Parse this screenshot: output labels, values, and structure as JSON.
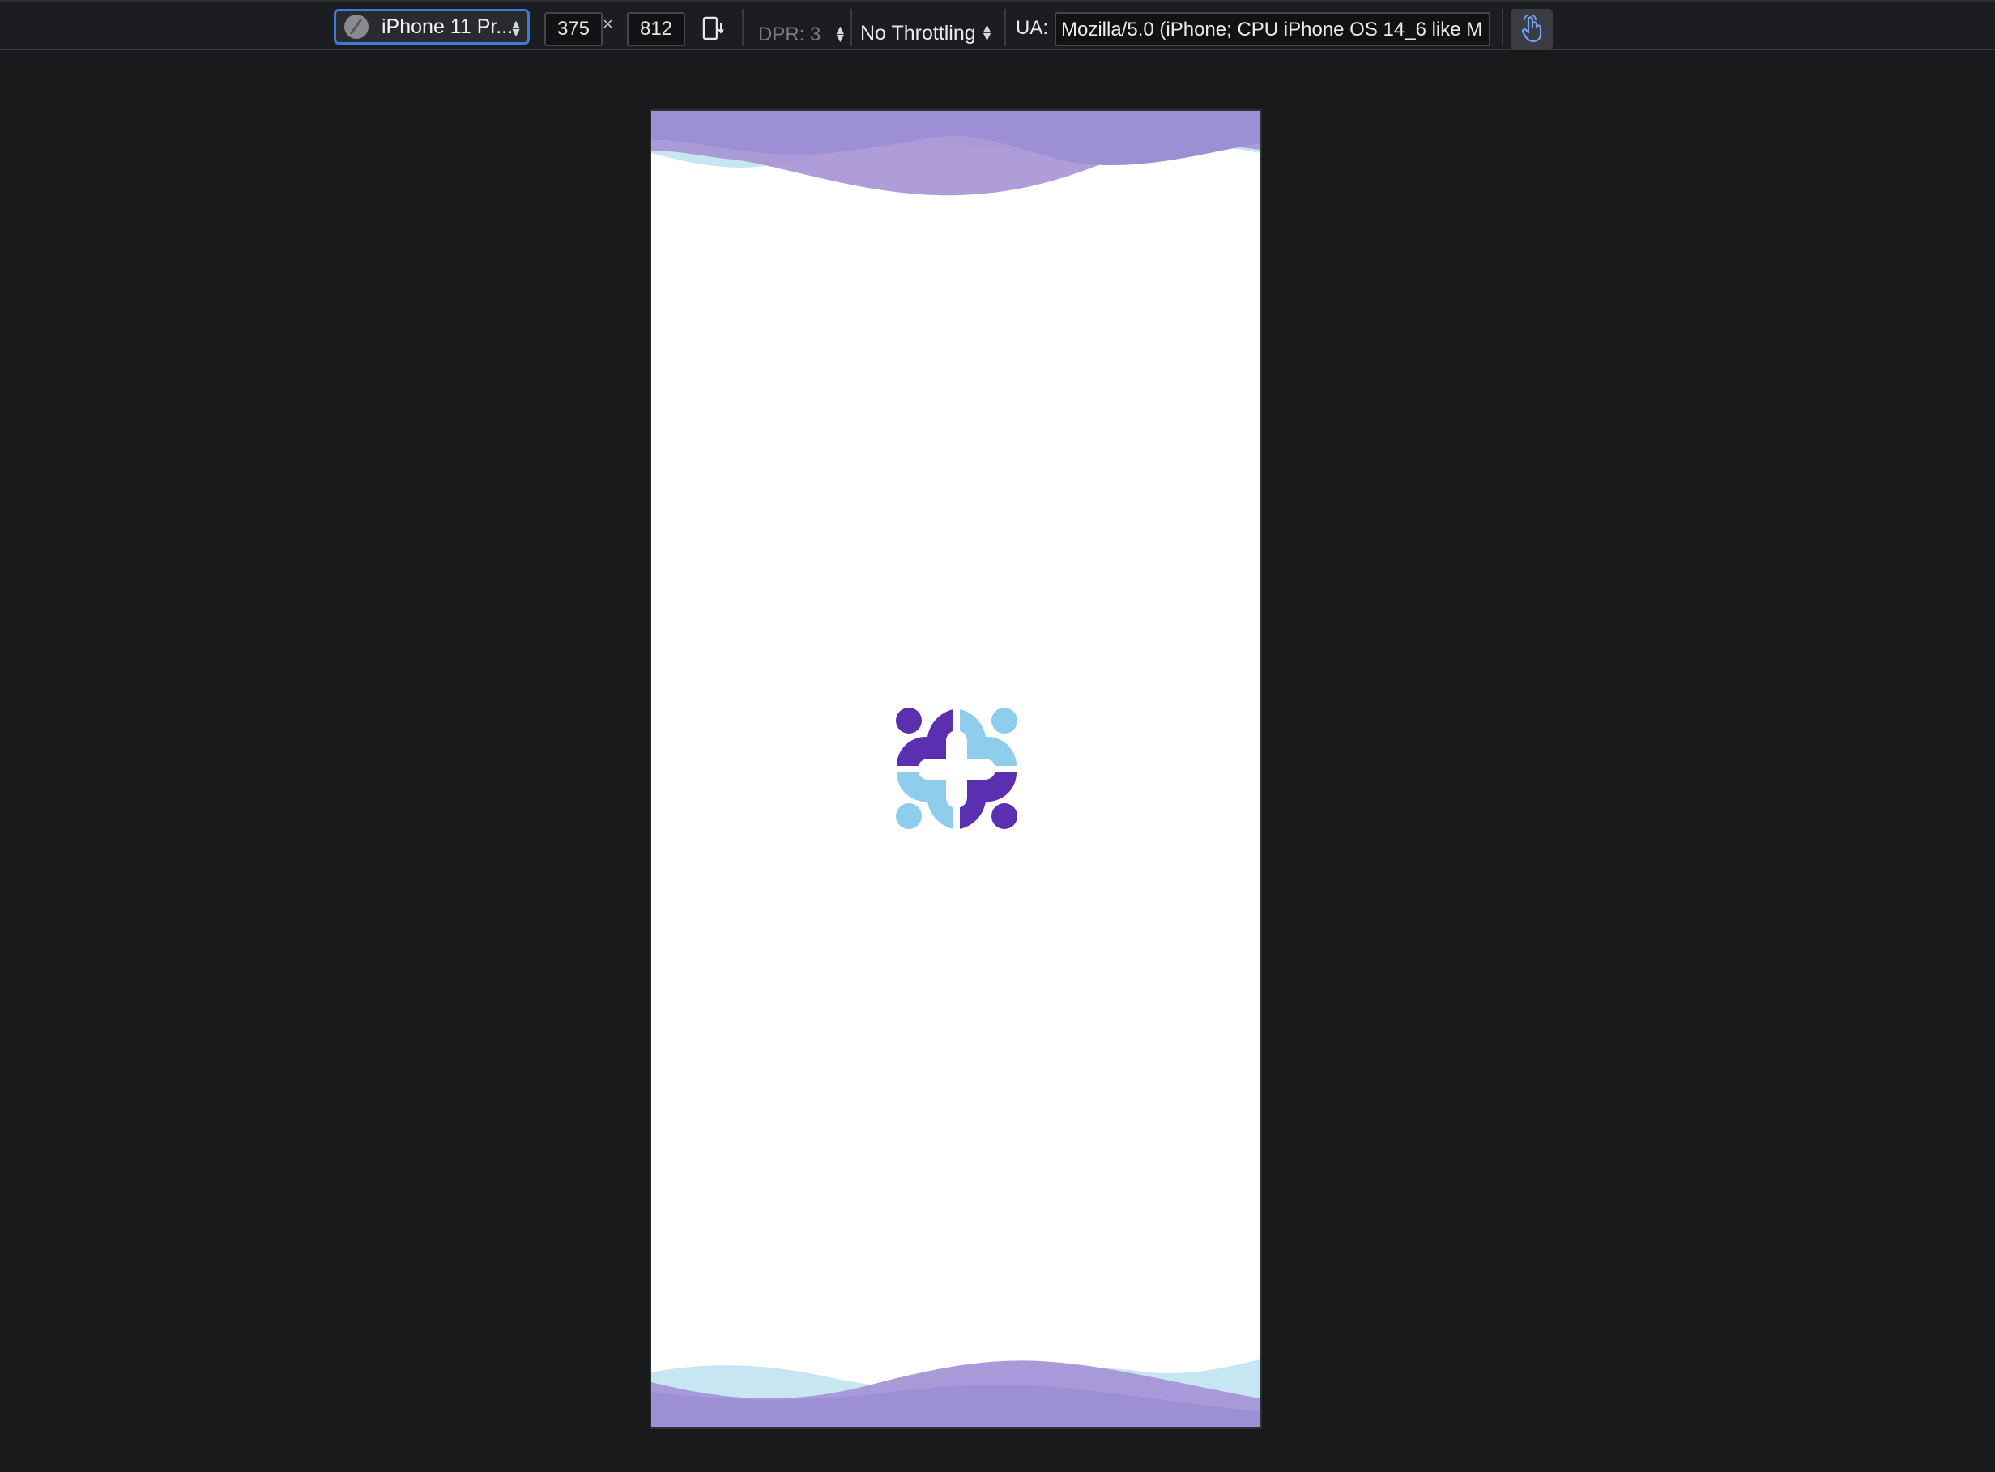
{
  "toolbar": {
    "device": {
      "label": "iPhone 11 Pr...",
      "icon": "globe-icon"
    },
    "width_value": "375",
    "times_symbol": "×",
    "height_value": "812",
    "rotate_icon": "rotate-device-icon",
    "dpr_label": "DPR: 3",
    "throttling_label": "No Throttling",
    "ua_label": "UA:",
    "ua_value": "Mozilla/5.0 (iPhone; CPU iPhone OS 14_6 like M",
    "touch_icon": "touch-simulation-icon"
  },
  "colors": {
    "background": "#18191b",
    "accent": "#3d7bd8",
    "wave_purple": "#9c8fd4",
    "wave_blue": "#c6e6f2",
    "logo_purple": "#5a2fb0",
    "logo_blue": "#8ecdec"
  },
  "page": {
    "logo": "medical-cross-logo"
  }
}
